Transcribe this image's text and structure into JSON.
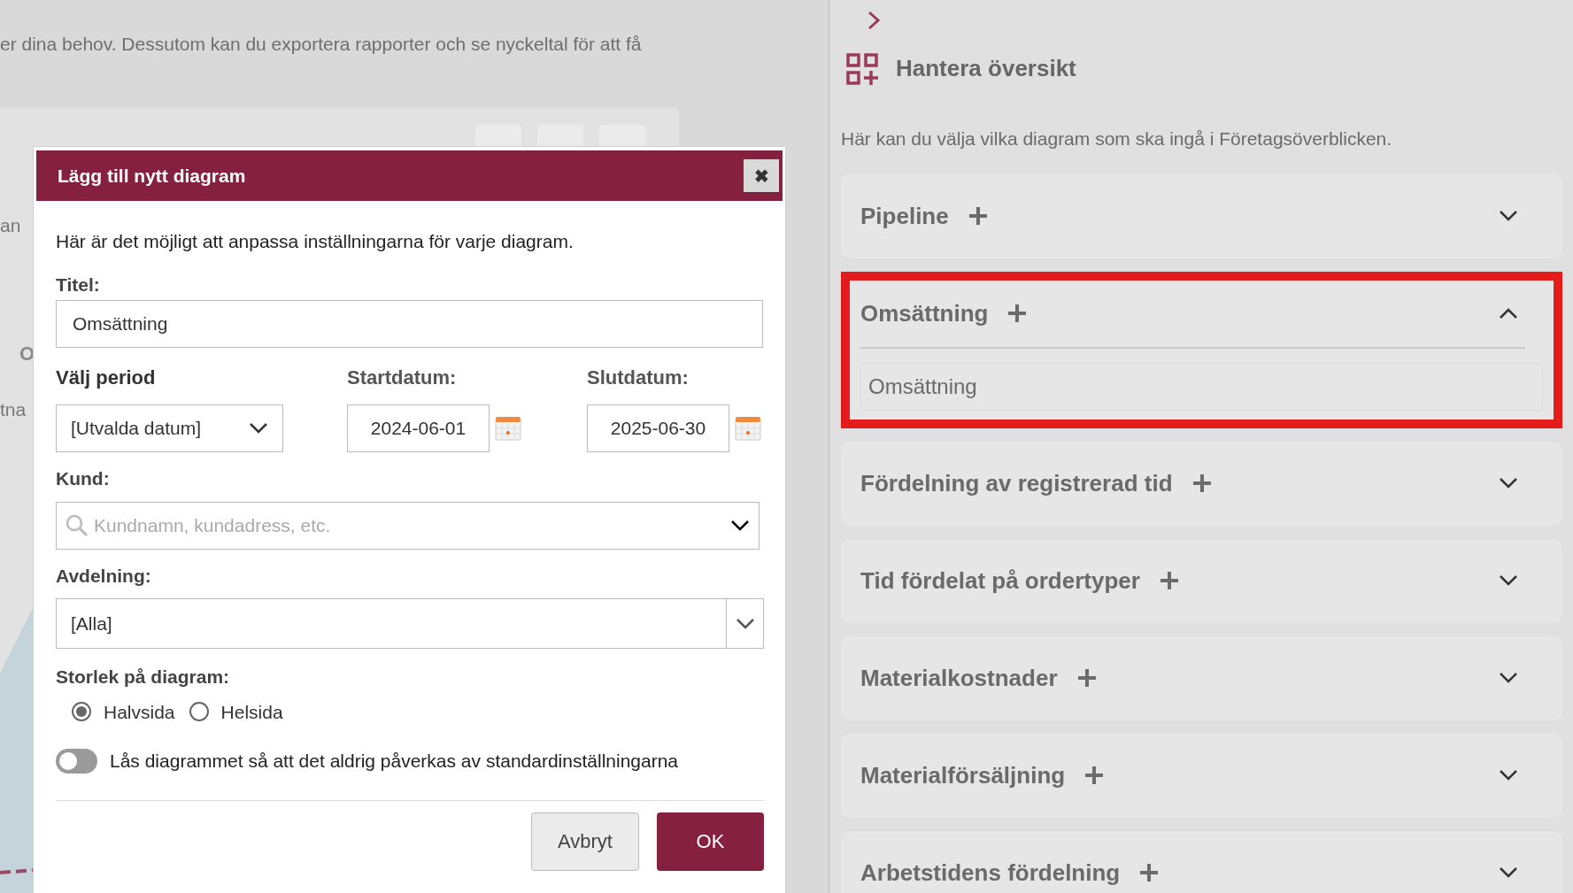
{
  "background": {
    "intro": "er dina behov. Dessutom kan du exportera rapporter och se nyckeltal för att få",
    "fragments": [
      "an",
      "O",
      "tna"
    ]
  },
  "dialog": {
    "title": "Lägg till nytt diagram",
    "close": "✖",
    "intro": "Här är det möjligt att anpassa inställningarna för varje diagram.",
    "title_label": "Titel:",
    "title_value": "Omsättning",
    "period_label": "Välj period",
    "period_value": "[Utvalda datum]",
    "start_label": "Startdatum:",
    "start_value": "2024-06-01",
    "end_label": "Slutdatum:",
    "end_value": "2025-06-30",
    "customer_label": "Kund:",
    "customer_placeholder": "Kundnamn, kundadress, etc.",
    "department_label": "Avdelning:",
    "department_value": "[Alla]",
    "size_label": "Storlek på diagram:",
    "sizes": [
      {
        "label": "Halvsida",
        "selected": true
      },
      {
        "label": "Helsida",
        "selected": false
      }
    ],
    "lock": {
      "label": "Lås diagrammet så att det aldrig påverkas av standardinställningarna",
      "on": false
    },
    "buttons": [
      {
        "label": "Avbryt",
        "kind": "secondary"
      },
      {
        "label": "OK",
        "kind": "primary"
      }
    ]
  },
  "panel": {
    "title": "Hantera översikt",
    "description": "Här kan du välja vilka diagram som ska ingå i Företagsöverblicken.",
    "items": [
      {
        "label": "Pipeline",
        "expanded": false,
        "highlighted": false
      },
      {
        "label": "Omsättning",
        "expanded": true,
        "highlighted": true,
        "content": "Omsättning"
      },
      {
        "label": "Fördelning av registrerad tid",
        "expanded": false,
        "highlighted": false
      },
      {
        "label": "Tid fördelat på ordertyper",
        "expanded": false,
        "highlighted": false
      },
      {
        "label": "Materialkostnader",
        "expanded": false,
        "highlighted": false
      },
      {
        "label": "Materialförsäljning",
        "expanded": false,
        "highlighted": false
      },
      {
        "label": "Arbetstidens fördelning",
        "expanded": false,
        "highlighted": false
      }
    ]
  }
}
